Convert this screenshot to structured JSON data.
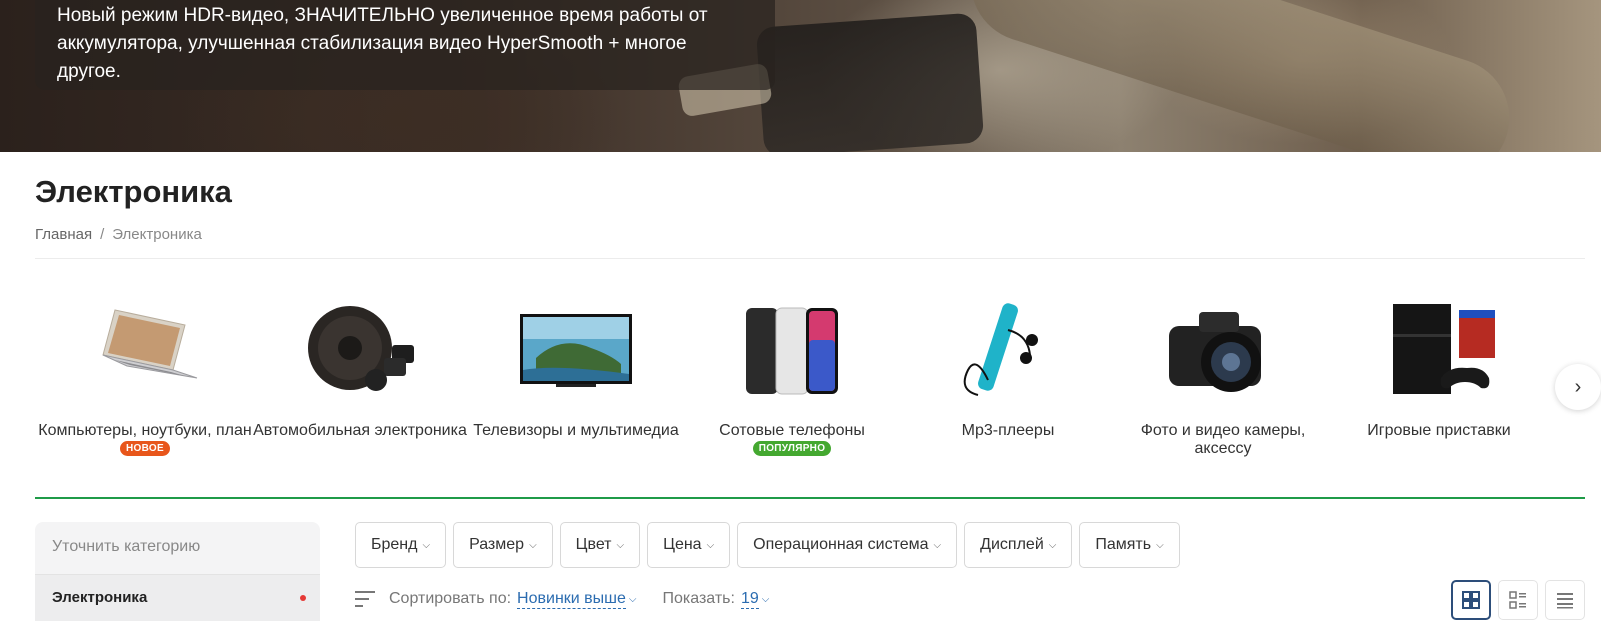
{
  "banner": {
    "line1": "Новый режим HDR-видео, ЗНАЧИТЕЛЬНО увеличенное время работы от",
    "line2": "аккумулятора, улучшенная стабилизация видео HyperSmooth + многое",
    "line3": "другое."
  },
  "page": {
    "title": "Электроника"
  },
  "breadcrumb": {
    "home": "Главная",
    "sep": "/",
    "current": "Электроника"
  },
  "categories": [
    {
      "label": "Компьютеры, ноутбуки, план",
      "badge": "НОВОЕ"
    },
    {
      "label": "Автомобильная электроника"
    },
    {
      "label": "Телевизоры и мультимедиа"
    },
    {
      "label": "Сотовые телефоны",
      "badge": "ПОПУЛЯРНО"
    },
    {
      "label": "Mp3-плееры"
    },
    {
      "label": "Фото и видео камеры, аксессу"
    },
    {
      "label": "Игровые приставки"
    }
  ],
  "sidebar": {
    "head": "Уточнить категорию",
    "item": "Электроника"
  },
  "filters": [
    "Бренд",
    "Размер",
    "Цвет",
    "Цена",
    "Операционная система",
    "Дисплей",
    "Память"
  ],
  "sort": {
    "label": "Сортировать по:",
    "value": "Новинки выше",
    "show_label": "Показать:",
    "show_value": "19"
  },
  "colors": {
    "accent_green": "#1f9b48",
    "badge_new": "#e8561b",
    "badge_popular": "#44a830",
    "link": "#2b6cb0"
  }
}
